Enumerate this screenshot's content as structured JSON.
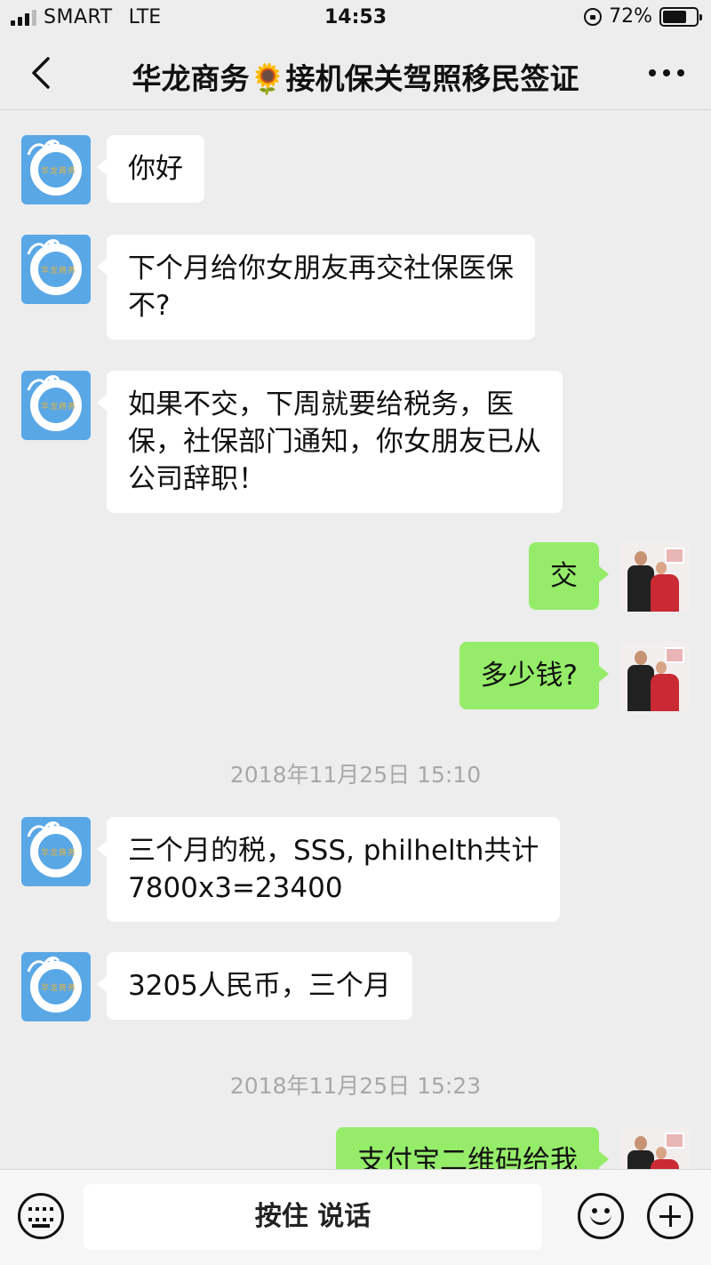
{
  "status_bar": {
    "carrier": "SMART",
    "network": "LTE",
    "time": "14:53",
    "battery": "72%",
    "battery_level": 0.72
  },
  "nav": {
    "title": "华龙商务🌻接机保关驾照移民签证"
  },
  "bot_avatar_text": "华龙商务",
  "messages": [
    {
      "side": "in",
      "text": "你好"
    },
    {
      "side": "in",
      "text": "下个月给你女朋友再交社保医保\n不?"
    },
    {
      "side": "in",
      "text": "如果不交，下周就要给税务，医\n保，社保部门通知，你女朋友已从\n公司辞职！"
    },
    {
      "side": "out",
      "text": "交"
    },
    {
      "side": "out",
      "text": "多少钱?"
    },
    {
      "type": "time",
      "text": "2018年11月25日 15:10"
    },
    {
      "side": "in",
      "text": "三个月的税，SSS, philhelth共计\n7800x3=23400"
    },
    {
      "side": "in",
      "text": "3205人民币，三个月"
    },
    {
      "type": "time",
      "text": "2018年11月25日 15:23"
    },
    {
      "side": "out",
      "text": "支付宝二维码给我"
    }
  ],
  "bottom_bar": {
    "voice_label": "按住 说话"
  }
}
